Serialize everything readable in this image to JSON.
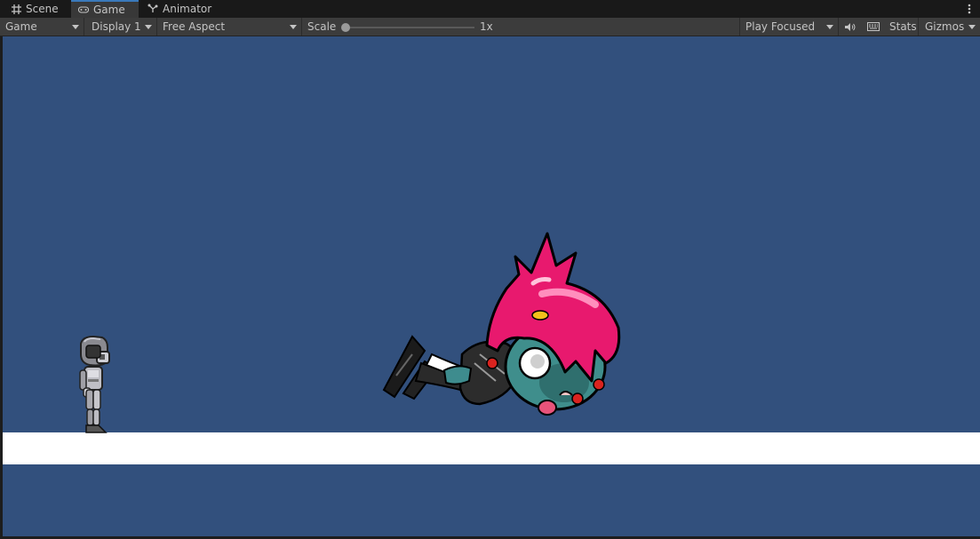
{
  "tabs": [
    {
      "label": "Scene",
      "icon": "grid-icon",
      "active": false
    },
    {
      "label": "Game",
      "icon": "gamepad-icon",
      "active": true
    },
    {
      "label": "Animator",
      "icon": "animator-icon",
      "active": false
    }
  ],
  "toolbar": {
    "view_dropdown": "Game",
    "display_dropdown": "Display 1",
    "aspect_dropdown": "Free Aspect",
    "scale_label": "Scale",
    "scale_value": "1x",
    "play_mode_dropdown": "Play Focused",
    "stats_label": "Stats",
    "gizmos_label": "Gizmos"
  },
  "scale_slider_fraction": 0.0,
  "colors": {
    "viewport_bg": "#32507d",
    "ground": "#ffffff",
    "tab_accent": "#3a79bb"
  },
  "scene": {
    "characters": [
      "robot-player",
      "pink-hair-zombie"
    ]
  }
}
